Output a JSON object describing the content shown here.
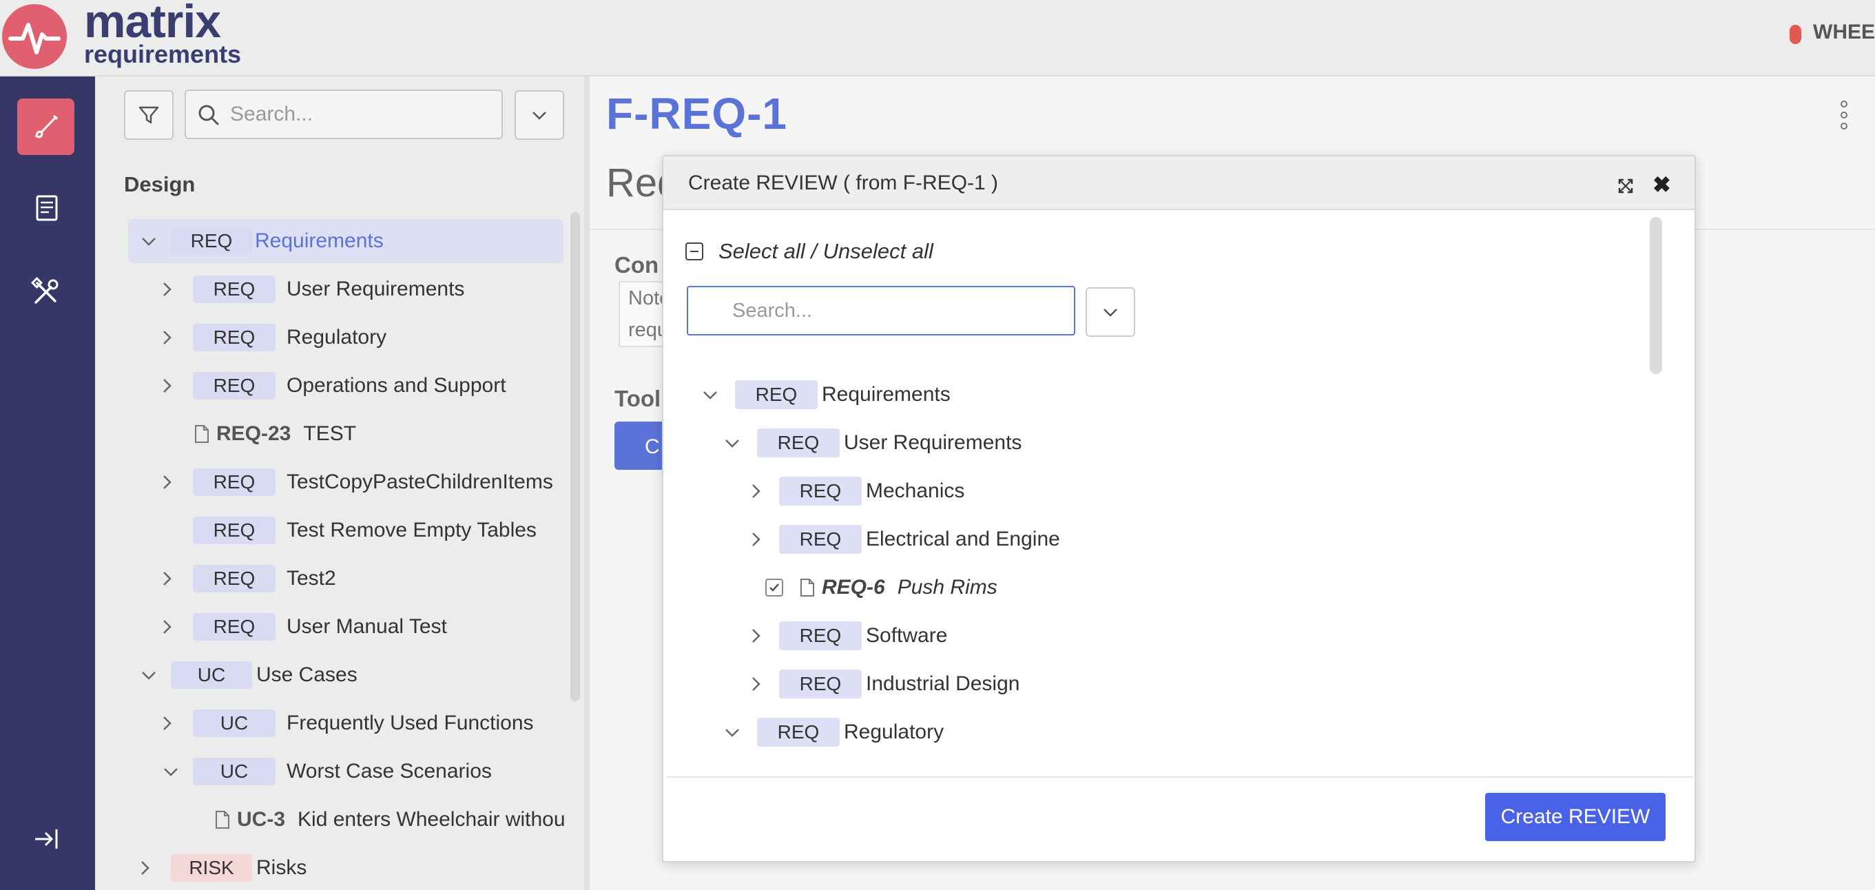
{
  "header": {
    "logo_word1": "matrix",
    "logo_word2": "requirements",
    "project_name": "WHEEL"
  },
  "rail": {
    "items": [
      "design-brush-icon",
      "document-book-icon",
      "tools-icon"
    ],
    "bottom": "collapse-icon"
  },
  "tree": {
    "search_placeholder": "Search...",
    "section_title": "Design",
    "rows": [
      {
        "badge": "REQ",
        "label": "Requirements"
      },
      {
        "badge": "REQ",
        "label": "User Requirements"
      },
      {
        "badge": "REQ",
        "label": "Regulatory"
      },
      {
        "badge": "REQ",
        "label": "Operations and Support"
      },
      {
        "id": "REQ-23",
        "label": "TEST"
      },
      {
        "badge": "REQ",
        "label": "TestCopyPasteChildrenItems"
      },
      {
        "badge": "REQ",
        "label": "Test Remove Empty Tables"
      },
      {
        "badge": "REQ",
        "label": "Test2"
      },
      {
        "badge": "REQ",
        "label": "User Manual Test"
      },
      {
        "badge": "UC",
        "label": "Use Cases"
      },
      {
        "badge": "UC",
        "label": "Frequently Used Functions"
      },
      {
        "badge": "UC",
        "label": "Worst Case Scenarios"
      },
      {
        "id": "UC-3",
        "label": "Kid enters Wheelchair withou"
      },
      {
        "badge": "RISK",
        "label": "Risks"
      }
    ]
  },
  "main": {
    "title": "F-REQ-1",
    "subtitle": "Req",
    "contents_label": "Con",
    "note_line1": "Note",
    "note_line2": "requ",
    "tools_label": "Tool",
    "button_clip": "C"
  },
  "dialog": {
    "title": "Create REVIEW ( from F-REQ-1 )",
    "select_all": "Select all / Unselect all",
    "search_placeholder": "Search...",
    "create_button": "Create REVIEW",
    "rows": [
      {
        "badge": "REQ",
        "label": "Requirements"
      },
      {
        "badge": "REQ",
        "label": "User Requirements"
      },
      {
        "badge": "REQ",
        "label": "Mechanics"
      },
      {
        "badge": "REQ",
        "label": "Electrical and Engine"
      },
      {
        "id": "REQ-6",
        "label": "Push Rims"
      },
      {
        "badge": "REQ",
        "label": "Software"
      },
      {
        "badge": "REQ",
        "label": "Industrial Design"
      },
      {
        "badge": "REQ",
        "label": "Regulatory"
      }
    ]
  },
  "colors": {
    "accent": "#5b73d9",
    "rail": "#363766",
    "rail_active": "#e06070",
    "button": "#4a62e8"
  }
}
